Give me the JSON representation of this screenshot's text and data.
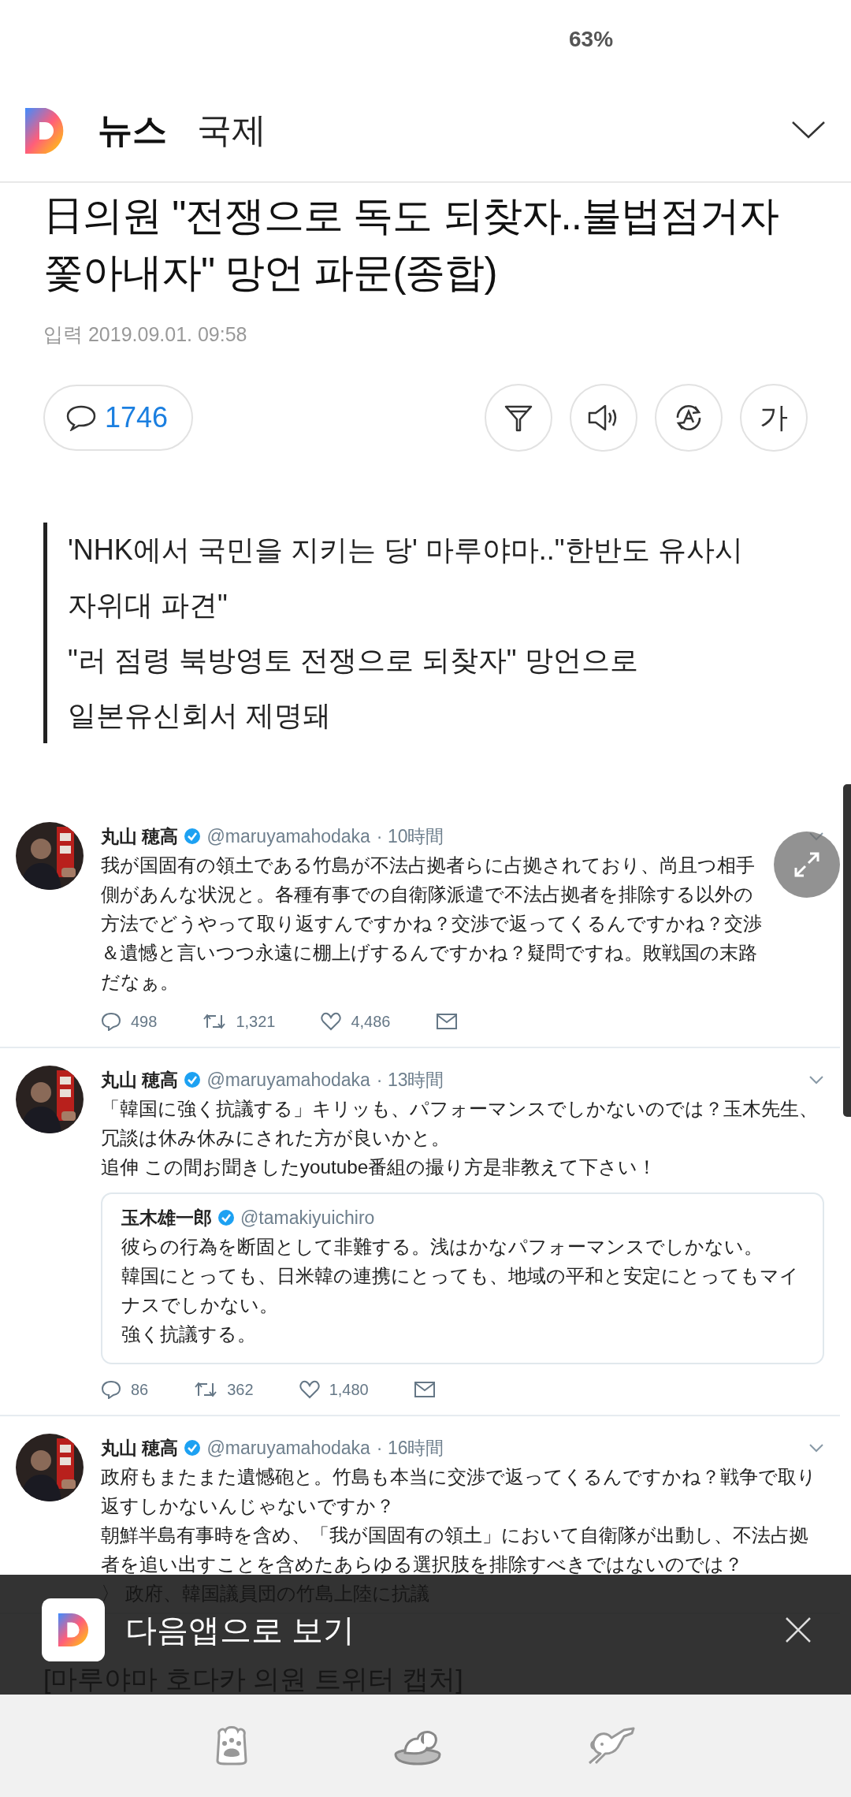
{
  "status_bar": {
    "battery": "63%"
  },
  "header": {
    "section": "뉴스",
    "category": "국제"
  },
  "article": {
    "title": "日의원 \"전쟁으로 독도 되찾자..불법점거자 쫓아내자\" 망언 파문(종합)",
    "date": "입력 2019.09.01. 09:58",
    "comment_count": "1746",
    "font_button": "가",
    "summary": [
      "'NHK에서 국민을 지키는 당' 마루야마..\"한반도 유사시 자위대 파견\"",
      "\"러 점령 북방영토 전쟁으로 되찾자\" 망언으로 일본유신회서 제명돼"
    ]
  },
  "embedded_image": {
    "tweets": [
      {
        "name": "丸山 穂高",
        "handle": "@maruyamahodaka",
        "time": "· 10時間",
        "text": [
          "我が国固有の領土である竹島が不法占拠者らに占拠されており、尚且つ相手側があんな状況と。各種有事での自衛隊派遣で不法占拠者を排除する以外の方法でどうやって取り返すんですかね？交渉で返ってくるんですかね？交渉＆遺憾と言いつつ永遠に棚上げするんですかね？疑問ですね。敗戦国の末路だなぁ。"
        ],
        "replies": "498",
        "retweets": "1,321",
        "likes": "4,486"
      },
      {
        "name": "丸山 穂高",
        "handle": "@maruyamahodaka",
        "time": "· 13時間",
        "text": [
          "「韓国に強く抗議する」キリッも、パフォーマンスでしかないのでは？玉木先生、冗談は休み休みにされた方が良いかと。",
          "追伸 この間お聞きしたyoutube番組の撮り方是非教えて下さい！"
        ],
        "quote": {
          "name": "玉木雄一郎",
          "handle": "@tamakiyuichiro",
          "text": [
            "彼らの行為を断固として非難する。浅はかなパフォーマンスでしかない。",
            "韓国にとっても、日米韓の連携にとっても、地域の平和と安定にとってもマイナスでしかない。",
            "強く抗議する。"
          ]
        },
        "replies": "86",
        "retweets": "362",
        "likes": "1,480"
      },
      {
        "name": "丸山 穂高",
        "handle": "@maruyamahodaka",
        "time": "· 16時間",
        "text": [
          "政府もまたまた遺憾砲と。竹島も本当に交渉で返ってくるんですかね？戦争で取り返すしかないんじゃないですか？",
          "朝鮮半島有事時を含め、「我が国固有の領土」において自衛隊が出動し、不法占拠者を追い出すことを含めたあらゆる選択肢を排除すべきではないのでは？"
        ],
        "link": "〉 政府、韓国議員団の竹島上陸に抗議"
      }
    ],
    "caption": "[마루야마 호다카 의원 트위터 캡처]"
  },
  "app_banner": {
    "label": "다음앱으로 보기"
  }
}
